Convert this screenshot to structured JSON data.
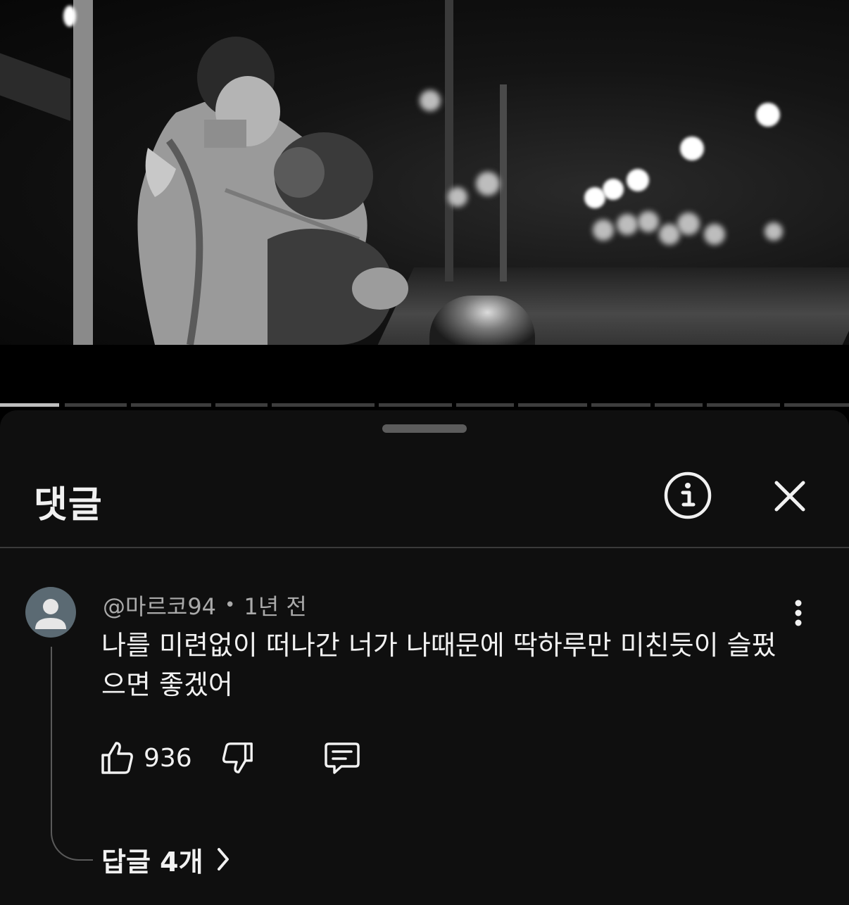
{
  "sheet": {
    "title": "댓글"
  },
  "comment": {
    "author": "@마르코94",
    "separator": "•",
    "time": "1년 전",
    "text": "나를 미련없이 떠나간 너가 나때문에 딱하루만 미친듯이 슬펐으면 좋겠어",
    "like_count": "936",
    "replies_label": "답글 4개"
  },
  "icons": {
    "info": "info-circle-icon",
    "close": "close-icon",
    "more": "more-vert-icon",
    "like": "thumb-up-icon",
    "dislike": "thumb-down-icon",
    "reply": "comment-icon",
    "replies": "chevron-right-icon",
    "avatar": "default-avatar-icon"
  },
  "colors": {
    "sheet_bg": "#0f0f0f",
    "text_primary": "#f1f1f1",
    "text_secondary": "#aaaaaa",
    "avatar_bg": "#5b6a73"
  },
  "video": {
    "progress_played_segments": 1,
    "progress_total_segments": 12
  }
}
